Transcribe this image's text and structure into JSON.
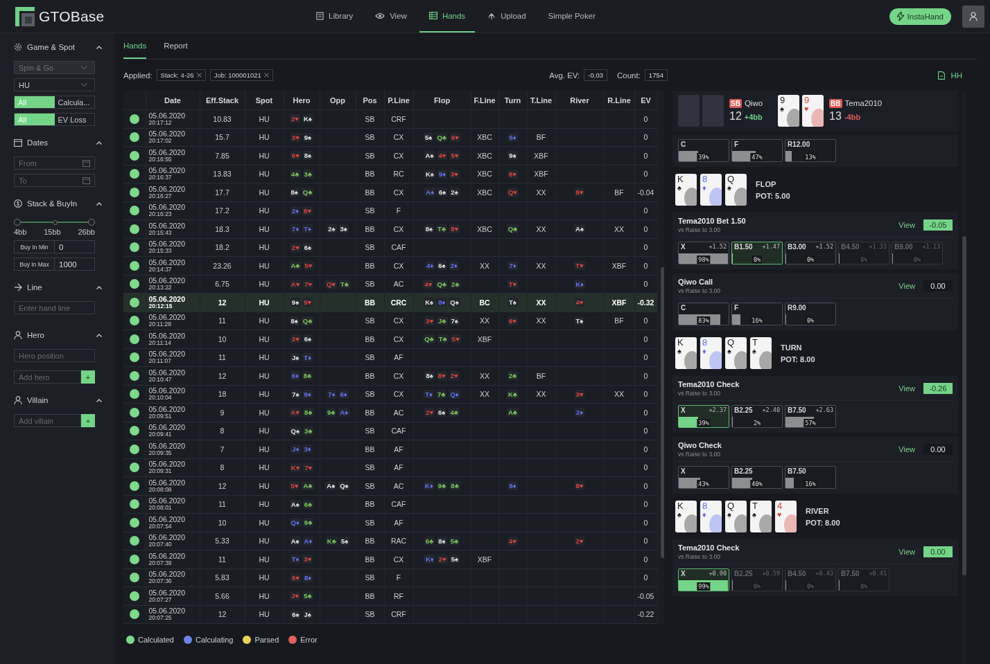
{
  "header": {
    "brand": "GTOBase",
    "nav": [
      {
        "label": "Library",
        "selected": false
      },
      {
        "label": "View",
        "selected": false
      },
      {
        "label": "Hands",
        "selected": true
      },
      {
        "label": "Upload",
        "selected": false
      },
      {
        "label": "Simple Poker",
        "selected": false
      }
    ],
    "insta_button": "InstaHand"
  },
  "sidebar": {
    "sections": [
      {
        "title": "Game & Spot",
        "expanded": true,
        "controls": [
          {
            "kind": "dropdown",
            "value": "Spin & Go",
            "disabled": true
          },
          {
            "kind": "dropdown",
            "value": "HU",
            "disabled": false
          },
          {
            "kind": "toggle",
            "options": [
              {
                "label": "All",
                "selected": true
              },
              {
                "label": "Calcula...",
                "selected": false
              }
            ]
          },
          {
            "kind": "toggle",
            "options": [
              {
                "label": "All",
                "selected": true
              },
              {
                "label": "EV Loss",
                "selected": false
              }
            ]
          }
        ]
      },
      {
        "title": "Dates",
        "expanded": true,
        "controls": [
          {
            "kind": "date",
            "placeholder": "From"
          },
          {
            "kind": "date",
            "placeholder": "To"
          }
        ]
      },
      {
        "title": "Stack & BuyIn",
        "expanded": true,
        "controls": [
          {
            "kind": "range",
            "level": 1,
            "ticks": [
              "4bb",
              "15bb",
              "26bb"
            ]
          },
          {
            "kind": "labeled-input",
            "label": "Buy In Min",
            "value": "0"
          },
          {
            "kind": "labeled-input",
            "label": "Buy In Max",
            "value": "1000"
          }
        ]
      },
      {
        "title": "Line",
        "expanded": true,
        "controls": [
          {
            "kind": "input",
            "placeholder": "Enter hand line"
          }
        ]
      },
      {
        "title": "Hero",
        "expanded": true,
        "controls": [
          {
            "kind": "input",
            "placeholder": "Hero position"
          },
          {
            "kind": "add-input",
            "placeholder": "Add hero",
            "button": "+"
          }
        ]
      },
      {
        "title": "Villain",
        "expanded": true,
        "controls": [
          {
            "kind": "add-input",
            "placeholder": "Add villain",
            "button": "+"
          }
        ]
      }
    ]
  },
  "main": {
    "tabs": [
      {
        "label": "Hands",
        "selected": true
      },
      {
        "label": "Report",
        "selected": false
      }
    ],
    "applied_label": "Applied:",
    "filters": [
      "Stack: 4-26",
      "Job: 100001021"
    ],
    "avg_ev_label": "Avg. EV:",
    "avg_ev": "-0.03",
    "count_label": "Count:",
    "count": "1754",
    "hh_button": "HH"
  },
  "table": {
    "columns": [
      "Date",
      "Eff.Stack",
      "Spot",
      "Hero",
      "Opp",
      "Pos",
      "P.Line",
      "Flop",
      "F.Line",
      "Turn",
      "T.Line",
      "River",
      "R.Line",
      "EV"
    ],
    "rows": [
      {
        "color": "#7ed98a",
        "date": "05.06.2020",
        "time": "20:17:12",
        "eff_stack": "10.83",
        "spot": "HU",
        "hero": [
          {
            "card": "2♥",
            "color": "#d8453e"
          },
          {
            "card": "K♠",
            "color": "#e4e4e4"
          }
        ],
        "pos": "SB",
        "p_line": "CRF",
        "ev": "0",
        "selected": false
      },
      {
        "color": "#7ed98a",
        "date": "05.06.2020",
        "time": "20:17:02",
        "eff_stack": "15.7",
        "spot": "HU",
        "hero": [
          {
            "card": "3♥",
            "color": "#d8453e"
          },
          {
            "card": "9♠",
            "color": "#e4e4e4"
          }
        ],
        "pos": "SB",
        "p_line": "CX",
        "flop": [
          {
            "card": "5♠",
            "color": "#e4e4e4"
          },
          {
            "card": "Q♣",
            "color": "#7bc95a"
          },
          {
            "card": "6♥",
            "color": "#d8453e"
          }
        ],
        "f_line": "XBC",
        "turn": [
          {
            "card": "5♦",
            "color": "#6272f0"
          }
        ],
        "t_line": "BF",
        "ev": "0",
        "selected": false
      },
      {
        "color": "#7ed98a",
        "date": "05.06.2020",
        "time": "20:16:55",
        "eff_stack": "7.85",
        "spot": "HU",
        "hero": [
          {
            "card": "6♥",
            "color": "#d8453e"
          },
          {
            "card": "8♠",
            "color": "#e4e4e4"
          }
        ],
        "pos": "SB",
        "p_line": "CX",
        "flop": [
          {
            "card": "A♠",
            "color": "#e4e4e4"
          },
          {
            "card": "4♥",
            "color": "#d8453e"
          },
          {
            "card": "5♥",
            "color": "#d8453e"
          }
        ],
        "f_line": "XBC",
        "turn": [
          {
            "card": "9♠",
            "color": "#e4e4e4"
          }
        ],
        "t_line": "XBF",
        "ev": "0",
        "selected": false
      },
      {
        "color": "#7ed98a",
        "date": "05.06.2020",
        "time": "20:16:37",
        "eff_stack": "13.83",
        "spot": "HU",
        "hero": [
          {
            "card": "4♣",
            "color": "#7bc95a"
          },
          {
            "card": "3♣",
            "color": "#7bc95a"
          }
        ],
        "pos": "BB",
        "p_line": "RC",
        "flop": [
          {
            "card": "K♠",
            "color": "#e4e4e4"
          },
          {
            "card": "9♦",
            "color": "#6272f0"
          },
          {
            "card": "3♥",
            "color": "#d8453e"
          }
        ],
        "f_line": "XBC",
        "turn": [
          {
            "card": "8♥",
            "color": "#d8453e"
          }
        ],
        "t_line": "XBF",
        "ev": "0",
        "selected": false
      },
      {
        "color": "#7ed98a",
        "date": "05.06.2020",
        "time": "20:16:27",
        "eff_stack": "17.7",
        "spot": "HU",
        "hero": [
          {
            "card": "8♠",
            "color": "#e4e4e4"
          },
          {
            "card": "Q♣",
            "color": "#7bc95a"
          }
        ],
        "pos": "BB",
        "p_line": "CX",
        "flop": [
          {
            "card": "A♦",
            "color": "#6272f0"
          },
          {
            "card": "6♠",
            "color": "#e4e4e4"
          },
          {
            "card": "2♠",
            "color": "#e4e4e4"
          }
        ],
        "f_line": "XBC",
        "turn": [
          {
            "card": "Q♥",
            "color": "#d8453e"
          }
        ],
        "t_line": "XX",
        "river": [
          {
            "card": "8♥",
            "color": "#d8453e"
          }
        ],
        "r_line": "BF",
        "ev": "-0.04",
        "selected": false
      },
      {
        "color": "#7ed98a",
        "date": "05.06.2020",
        "time": "20:16:23",
        "eff_stack": "17.2",
        "spot": "HU",
        "hero": [
          {
            "card": "2♦",
            "color": "#6272f0"
          },
          {
            "card": "8♥",
            "color": "#d8453e"
          }
        ],
        "pos": "SB",
        "p_line": "F",
        "ev": "0",
        "selected": false
      },
      {
        "color": "#7ed98a",
        "date": "05.06.2020",
        "time": "20:15:43",
        "eff_stack": "18.3",
        "spot": "HU",
        "hero": [
          {
            "card": "7♦",
            "color": "#6272f0"
          },
          {
            "card": "T♦",
            "color": "#6272f0"
          }
        ],
        "opp": [
          {
            "card": "2♠",
            "color": "#e4e4e4"
          },
          {
            "card": "3♠",
            "color": "#e4e4e4"
          }
        ],
        "pos": "BB",
        "p_line": "CX",
        "flop": [
          {
            "card": "8♠",
            "color": "#e4e4e4"
          },
          {
            "card": "T♣",
            "color": "#7bc95a"
          },
          {
            "card": "8♥",
            "color": "#d8453e"
          }
        ],
        "f_line": "XBC",
        "turn": [
          {
            "card": "Q♣",
            "color": "#7bc95a"
          }
        ],
        "t_line": "XX",
        "river": [
          {
            "card": "A♠",
            "color": "#e4e4e4"
          }
        ],
        "r_line": "XX",
        "ev": "0",
        "selected": false
      },
      {
        "color": "#7ed98a",
        "date": "05.06.2020",
        "time": "20:15:33",
        "eff_stack": "18.2",
        "spot": "HU",
        "hero": [
          {
            "card": "2♥",
            "color": "#d8453e"
          },
          {
            "card": "6♠",
            "color": "#e4e4e4"
          }
        ],
        "pos": "SB",
        "p_line": "CAF",
        "ev": "0",
        "selected": false
      },
      {
        "color": "#7ed98a",
        "date": "05.06.2020",
        "time": "20:14:37",
        "eff_stack": "23.26",
        "spot": "HU",
        "hero": [
          {
            "card": "A♣",
            "color": "#7bc95a"
          },
          {
            "card": "5♥",
            "color": "#d8453e"
          }
        ],
        "pos": "BB",
        "p_line": "CX",
        "flop": [
          {
            "card": "4♦",
            "color": "#6272f0"
          },
          {
            "card": "6♠",
            "color": "#e4e4e4"
          },
          {
            "card": "2♦",
            "color": "#6272f0"
          }
        ],
        "f_line": "XX",
        "turn": [
          {
            "card": "7♦",
            "color": "#6272f0"
          }
        ],
        "t_line": "XX",
        "river": [
          {
            "card": "T♥",
            "color": "#d8453e"
          }
        ],
        "r_line": "XBF",
        "ev": "0",
        "selected": false
      },
      {
        "color": "#7ed98a",
        "date": "05.06.2020",
        "time": "20:13:22",
        "eff_stack": "6.75",
        "spot": "HU",
        "hero": [
          {
            "card": "A♥",
            "color": "#d8453e"
          },
          {
            "card": "7♥",
            "color": "#d8453e"
          }
        ],
        "opp": [
          {
            "card": "Q♥",
            "color": "#d8453e"
          },
          {
            "card": "T♣",
            "color": "#7bc95a"
          }
        ],
        "pos": "SB",
        "p_line": "AC",
        "flop": [
          {
            "card": "4♥",
            "color": "#d8453e"
          },
          {
            "card": "Q♣",
            "color": "#7bc95a"
          },
          {
            "card": "2♣",
            "color": "#7bc95a"
          }
        ],
        "turn": [
          {
            "card": "T♥",
            "color": "#d8453e"
          }
        ],
        "river": [
          {
            "card": "K♦",
            "color": "#6272f0"
          }
        ],
        "ev": "0",
        "selected": false
      },
      {
        "color": "#7ed98a",
        "date": "05.06.2020",
        "time": "20:12:15",
        "eff_stack": "12",
        "spot": "HU",
        "hero": [
          {
            "card": "9♠",
            "color": "#e4e4e4"
          },
          {
            "card": "9♥",
            "color": "#d8453e"
          }
        ],
        "pos": "BB",
        "p_line": "CRC",
        "flop": [
          {
            "card": "K♠",
            "color": "#e4e4e4"
          },
          {
            "card": "8♦",
            "color": "#6272f0"
          },
          {
            "card": "Q♠",
            "color": "#e4e4e4"
          }
        ],
        "f_line": "BC",
        "turn": [
          {
            "card": "T♠",
            "color": "#e4e4e4"
          }
        ],
        "t_line": "XX",
        "river": [
          {
            "card": "4♥",
            "color": "#d8453e"
          }
        ],
        "r_line": "XBF",
        "ev": "-0.32",
        "selected": true
      },
      {
        "color": "#7ed98a",
        "date": "05.06.2020",
        "time": "20:11:28",
        "eff_stack": "11",
        "spot": "HU",
        "hero": [
          {
            "card": "8♠",
            "color": "#e4e4e4"
          },
          {
            "card": "Q♣",
            "color": "#7bc95a"
          }
        ],
        "pos": "SB",
        "p_line": "CX",
        "flop": [
          {
            "card": "3♥",
            "color": "#d8453e"
          },
          {
            "card": "J♣",
            "color": "#7bc95a"
          },
          {
            "card": "7♠",
            "color": "#e4e4e4"
          }
        ],
        "f_line": "XX",
        "turn": [
          {
            "card": "6♥",
            "color": "#d8453e"
          }
        ],
        "t_line": "XX",
        "river": [
          {
            "card": "T♠",
            "color": "#e4e4e4"
          }
        ],
        "r_line": "BF",
        "ev": "0",
        "selected": false
      },
      {
        "color": "#7ed98a",
        "date": "05.06.2020",
        "time": "20:11:14",
        "eff_stack": "10",
        "spot": "HU",
        "hero": [
          {
            "card": "3♥",
            "color": "#d8453e"
          },
          {
            "card": "6♠",
            "color": "#e4e4e4"
          }
        ],
        "pos": "BB",
        "p_line": "CX",
        "flop": [
          {
            "card": "Q♣",
            "color": "#7bc95a"
          },
          {
            "card": "T♣",
            "color": "#7bc95a"
          },
          {
            "card": "5♥",
            "color": "#d8453e"
          }
        ],
        "f_line": "XBF",
        "ev": "0",
        "selected": false
      },
      {
        "color": "#7ed98a",
        "date": "05.06.2020",
        "time": "20:11:07",
        "eff_stack": "11",
        "spot": "HU",
        "hero": [
          {
            "card": "J♠",
            "color": "#e4e4e4"
          },
          {
            "card": "T♦",
            "color": "#6272f0"
          }
        ],
        "pos": "SB",
        "p_line": "AF",
        "ev": "0",
        "selected": false
      },
      {
        "color": "#7ed98a",
        "date": "05.06.2020",
        "time": "20:10:47",
        "eff_stack": "12",
        "spot": "HU",
        "hero": [
          {
            "card": "6♦",
            "color": "#6272f0"
          },
          {
            "card": "8♣",
            "color": "#7bc95a"
          }
        ],
        "pos": "BB",
        "p_line": "CX",
        "flop": [
          {
            "card": "8♠",
            "color": "#e4e4e4"
          },
          {
            "card": "8♥",
            "color": "#d8453e"
          },
          {
            "card": "2♥",
            "color": "#d8453e"
          }
        ],
        "f_line": "XX",
        "turn": [
          {
            "card": "2♣",
            "color": "#7bc95a"
          }
        ],
        "t_line": "BF",
        "ev": "0",
        "selected": false
      },
      {
        "color": "#7ed98a",
        "date": "05.06.2020",
        "time": "20:10:04",
        "eff_stack": "18",
        "spot": "HU",
        "hero": [
          {
            "card": "7♠",
            "color": "#e4e4e4"
          },
          {
            "card": "9♦",
            "color": "#6272f0"
          }
        ],
        "opp": [
          {
            "card": "7♦",
            "color": "#6272f0"
          },
          {
            "card": "6♦",
            "color": "#6272f0"
          }
        ],
        "pos": "SB",
        "p_line": "CX",
        "flop": [
          {
            "card": "T♦",
            "color": "#6272f0"
          },
          {
            "card": "7♣",
            "color": "#7bc95a"
          },
          {
            "card": "Q♦",
            "color": "#6272f0"
          }
        ],
        "f_line": "XX",
        "turn": [
          {
            "card": "K♣",
            "color": "#7bc95a"
          }
        ],
        "t_line": "XX",
        "river": [
          {
            "card": "3♥",
            "color": "#d8453e"
          }
        ],
        "r_line": "XX",
        "ev": "0",
        "selected": false
      },
      {
        "color": "#7ed98a",
        "date": "05.06.2020",
        "time": "20:09:51",
        "eff_stack": "9",
        "spot": "HU",
        "hero": [
          {
            "card": "A♥",
            "color": "#d8453e"
          },
          {
            "card": "8♣",
            "color": "#7bc95a"
          }
        ],
        "opp": [
          {
            "card": "9♣",
            "color": "#7bc95a"
          },
          {
            "card": "A♦",
            "color": "#6272f0"
          }
        ],
        "pos": "BB",
        "p_line": "AC",
        "flop": [
          {
            "card": "2♥",
            "color": "#d8453e"
          },
          {
            "card": "6♠",
            "color": "#e4e4e4"
          },
          {
            "card": "4♣",
            "color": "#7bc95a"
          }
        ],
        "turn": [
          {
            "card": "A♣",
            "color": "#7bc95a"
          }
        ],
        "river": [
          {
            "card": "2♦",
            "color": "#6272f0"
          }
        ],
        "ev": "0",
        "selected": false
      },
      {
        "color": "#7ed98a",
        "date": "05.06.2020",
        "time": "20:09:41",
        "eff_stack": "8",
        "spot": "HU",
        "hero": [
          {
            "card": "Q♠",
            "color": "#e4e4e4"
          },
          {
            "card": "3♣",
            "color": "#7bc95a"
          }
        ],
        "pos": "SB",
        "p_line": "CAF",
        "ev": "0",
        "selected": false
      },
      {
        "color": "#7ed98a",
        "date": "05.06.2020",
        "time": "20:09:35",
        "eff_stack": "7",
        "spot": "HU",
        "hero": [
          {
            "card": "J♦",
            "color": "#6272f0"
          },
          {
            "card": "3♦",
            "color": "#6272f0"
          }
        ],
        "pos": "BB",
        "p_line": "AF",
        "ev": "0",
        "selected": false
      },
      {
        "color": "#7ed98a",
        "date": "05.06.2020",
        "time": "20:09:31",
        "eff_stack": "8",
        "spot": "HU",
        "hero": [
          {
            "card": "K♥",
            "color": "#d8453e"
          },
          {
            "card": "7♥",
            "color": "#d8453e"
          }
        ],
        "pos": "SB",
        "p_line": "AF",
        "ev": "0",
        "selected": false
      },
      {
        "color": "#7ed98a",
        "date": "05.06.2020",
        "time": "20:08:08",
        "eff_stack": "12",
        "spot": "HU",
        "hero": [
          {
            "card": "5♥",
            "color": "#d8453e"
          },
          {
            "card": "A♣",
            "color": "#7bc95a"
          }
        ],
        "opp": [
          {
            "card": "A♠",
            "color": "#e4e4e4"
          },
          {
            "card": "Q♠",
            "color": "#e4e4e4"
          }
        ],
        "pos": "SB",
        "p_line": "AC",
        "flop": [
          {
            "card": "K♦",
            "color": "#6272f0"
          },
          {
            "card": "9♣",
            "color": "#7bc95a"
          },
          {
            "card": "8♣",
            "color": "#7bc95a"
          }
        ],
        "turn": [
          {
            "card": "6♦",
            "color": "#6272f0"
          }
        ],
        "river": [
          {
            "card": "8♥",
            "color": "#d8453e"
          }
        ],
        "ev": "0",
        "selected": false
      },
      {
        "color": "#7ed98a",
        "date": "05.06.2020",
        "time": "20:08:01",
        "eff_stack": "11",
        "spot": "HU",
        "hero": [
          {
            "card": "A♠",
            "color": "#e4e4e4"
          },
          {
            "card": "6♣",
            "color": "#7bc95a"
          }
        ],
        "pos": "BB",
        "p_line": "CAF",
        "ev": "0",
        "selected": false
      },
      {
        "color": "#7ed98a",
        "date": "05.06.2020",
        "time": "20:07:54",
        "eff_stack": "10",
        "spot": "HU",
        "hero": [
          {
            "card": "Q♦",
            "color": "#6272f0"
          },
          {
            "card": "9♣",
            "color": "#7bc95a"
          }
        ],
        "pos": "SB",
        "p_line": "AF",
        "ev": "0",
        "selected": false
      },
      {
        "color": "#7ed98a",
        "date": "05.06.2020",
        "time": "20:07:40",
        "eff_stack": "5.33",
        "spot": "HU",
        "hero": [
          {
            "card": "A♠",
            "color": "#e4e4e4"
          },
          {
            "card": "A♦",
            "color": "#6272f0"
          }
        ],
        "opp": [
          {
            "card": "K♣",
            "color": "#7bc95a"
          },
          {
            "card": "5♠",
            "color": "#e4e4e4"
          }
        ],
        "pos": "BB",
        "p_line": "RAC",
        "flop": [
          {
            "card": "6♣",
            "color": "#7bc95a"
          },
          {
            "card": "8♠",
            "color": "#e4e4e4"
          },
          {
            "card": "5♣",
            "color": "#7bc95a"
          }
        ],
        "turn": [
          {
            "card": "4♥",
            "color": "#d8453e"
          }
        ],
        "river": [
          {
            "card": "2♥",
            "color": "#d8453e"
          }
        ],
        "ev": "0",
        "selected": false
      },
      {
        "color": "#7ed98a",
        "date": "05.06.2020",
        "time": "20:07:39",
        "eff_stack": "11",
        "spot": "HU",
        "hero": [
          {
            "card": "T♦",
            "color": "#6272f0"
          },
          {
            "card": "3♥",
            "color": "#d8453e"
          }
        ],
        "pos": "BB",
        "p_line": "CX",
        "flop": [
          {
            "card": "K♦",
            "color": "#6272f0"
          },
          {
            "card": "2♥",
            "color": "#d8453e"
          },
          {
            "card": "5♠",
            "color": "#e4e4e4"
          }
        ],
        "f_line": "XBF",
        "ev": "0",
        "selected": false
      },
      {
        "color": "#7ed98a",
        "date": "05.06.2020",
        "time": "20:07:36",
        "eff_stack": "5.83",
        "spot": "HU",
        "hero": [
          {
            "card": "6♥",
            "color": "#d8453e"
          },
          {
            "card": "8♦",
            "color": "#6272f0"
          }
        ],
        "pos": "SB",
        "p_line": "F",
        "ev": "0",
        "selected": false
      },
      {
        "color": "#7ed98a",
        "date": "05.06.2020",
        "time": "20:07:27",
        "eff_stack": "5.66",
        "spot": "HU",
        "hero": [
          {
            "card": "J♥",
            "color": "#d8453e"
          },
          {
            "card": "5♣",
            "color": "#7bc95a"
          }
        ],
        "pos": "BB",
        "p_line": "RF",
        "ev": "-0.05",
        "selected": false
      },
      {
        "color": "#7ed98a",
        "date": "05.06.2020",
        "time": "20:07:25",
        "eff_stack": "12",
        "spot": "HU",
        "hero": [
          {
            "card": "6♠",
            "color": "#e4e4e4"
          },
          {
            "card": "J♠",
            "color": "#e4e4e4"
          }
        ],
        "pos": "SB",
        "p_line": "CRF",
        "ev": "-0.22",
        "selected": false
      }
    ]
  },
  "legend": [
    {
      "label": "Calculated",
      "color": "#7ed98a"
    },
    {
      "label": "Calculating",
      "color": "#6b86e8"
    },
    {
      "label": "Parsed",
      "color": "#e8d25a"
    },
    {
      "label": "Error",
      "color": "#e0605a"
    }
  ],
  "panel": {
    "players": [
      {
        "position": "SB",
        "name": "Qiwo",
        "stack": "12",
        "result": "+4bb",
        "color": "#6fd08a",
        "cards_shown": false
      },
      {
        "position": "BB",
        "name": "Tema2010",
        "stack": "13",
        "result": "-4bb",
        "color": "#e0605a",
        "cards_shown": true,
        "cards": [
          {
            "rank": "9",
            "suit": "♠",
            "color": "#1a1a1a"
          },
          {
            "rank": "9",
            "suit": "♥",
            "color": "#d8453e"
          }
        ]
      }
    ],
    "streets": [
      {
        "kind": "decision",
        "options": [
          {
            "label": "C",
            "freq": "39%",
            "level": 0.39,
            "played": false,
            "dimmed": false
          },
          {
            "label": "F",
            "freq": "47%",
            "level": 0.47,
            "played": false,
            "dimmed": false
          },
          {
            "label": "R12.00",
            "freq": "13%",
            "level": 0.13,
            "played": false,
            "dimmed": false
          }
        ]
      },
      {
        "kind": "board",
        "street": "FLOP",
        "pot": "POT: 5.00",
        "cards": [
          {
            "rank": "K",
            "suit": "♠",
            "color": "#1a1a1a"
          },
          {
            "rank": "8",
            "suit": "♦",
            "color": "#5b6cf0"
          },
          {
            "rank": "Q",
            "suit": "♠",
            "color": "#1a1a1a"
          }
        ]
      },
      {
        "kind": "decision",
        "title": "Tema2010 Bet 1.50",
        "subtitle": "vs Raise to 3.00",
        "link": "View",
        "ev": "-0.05",
        "highlighted": true,
        "options": [
          {
            "label": "X",
            "ev": "+1.52",
            "freq": "98%",
            "level": 0.98,
            "played": false,
            "dimmed": false
          },
          {
            "label": "B1.50",
            "ev": "+1.47",
            "freq": "0%",
            "level": 0,
            "played": true,
            "dimmed": false
          },
          {
            "label": "B3.00",
            "ev": "+1.52",
            "freq": "0%",
            "level": 0,
            "played": false,
            "dimmed": false
          },
          {
            "label": "B4.50",
            "ev": "+1.33",
            "freq": "0%",
            "level": 0,
            "played": false,
            "dimmed": true
          },
          {
            "label": "B9.00",
            "ev": "+1.13",
            "freq": "0%",
            "level": 0,
            "played": false,
            "dimmed": true
          }
        ]
      },
      {
        "kind": "decision",
        "title": "Qiwo Call",
        "subtitle": "vs Raise to 3.00",
        "link": "View",
        "ev": "0.00",
        "highlighted": false,
        "options": [
          {
            "label": "C",
            "freq": "83%",
            "level": 0.83,
            "played": false,
            "dimmed": false
          },
          {
            "label": "F",
            "freq": "16%",
            "level": 0.16,
            "played": false,
            "dimmed": false
          },
          {
            "label": "R9.00",
            "freq": "0%",
            "level": 0,
            "played": false,
            "dimmed": false
          }
        ]
      },
      {
        "kind": "board",
        "street": "TURN",
        "pot": "POT: 8.00",
        "cards": [
          {
            "rank": "K",
            "suit": "♠",
            "color": "#1a1a1a"
          },
          {
            "rank": "8",
            "suit": "♦",
            "color": "#5b6cf0"
          },
          {
            "rank": "Q",
            "suit": "♠",
            "color": "#1a1a1a"
          },
          {
            "rank": "T",
            "suit": "♠",
            "color": "#1a1a1a"
          }
        ]
      },
      {
        "kind": "decision",
        "title": "Tema2010 Check",
        "subtitle": "vs Raise to 3.00",
        "link": "View",
        "ev": "-0.26",
        "highlighted": true,
        "options": [
          {
            "label": "X",
            "ev": "+2.37",
            "freq": "39%",
            "level": 0.39,
            "played": true,
            "dimmed": false
          },
          {
            "label": "B2.25",
            "ev": "+2.40",
            "freq": "2%",
            "level": 0.02,
            "played": false,
            "dimmed": false
          },
          {
            "label": "B7.50",
            "ev": "+2.63",
            "freq": "57%",
            "level": 0.57,
            "played": false,
            "dimmed": false
          }
        ]
      },
      {
        "kind": "decision",
        "title": "Qiwo Check",
        "subtitle": "vs Raise to 3.00",
        "link": "View",
        "ev": "0.00",
        "highlighted": false,
        "options": [
          {
            "label": "X",
            "freq": "43%",
            "level": 0.43,
            "played": false,
            "dimmed": false
          },
          {
            "label": "B2.25",
            "freq": "40%",
            "level": 0.4,
            "played": false,
            "dimmed": false
          },
          {
            "label": "B7.50",
            "freq": "16%",
            "level": 0.16,
            "played": false,
            "dimmed": false
          }
        ]
      },
      {
        "kind": "board",
        "street": "RIVER",
        "pot": "POT: 8.00",
        "cards": [
          {
            "rank": "K",
            "suit": "♠",
            "color": "#1a1a1a"
          },
          {
            "rank": "8",
            "suit": "♦",
            "color": "#5b6cf0"
          },
          {
            "rank": "Q",
            "suit": "♠",
            "color": "#1a1a1a"
          },
          {
            "rank": "T",
            "suit": "♠",
            "color": "#1a1a1a"
          },
          {
            "rank": "4",
            "suit": "♥",
            "color": "#d8453e"
          }
        ]
      },
      {
        "kind": "decision",
        "title": "Tema2010 Check",
        "subtitle": "vs Raise to 3.00",
        "link": "View",
        "ev": "0.00",
        "highlighted": true,
        "options": [
          {
            "label": "X",
            "ev": "+0.90",
            "freq": "99%",
            "level": 0.99,
            "played": true,
            "dimmed": false
          },
          {
            "label": "B2.25",
            "ev": "+0.59",
            "freq": "0%",
            "level": 0,
            "played": false,
            "dimmed": true
          },
          {
            "label": "B4.50",
            "ev": "+0.43",
            "freq": "0%",
            "level": 0,
            "played": false,
            "dimmed": true
          },
          {
            "label": "B7.50",
            "ev": "+0.41",
            "freq": "0%",
            "level": 0,
            "played": false,
            "dimmed": true
          }
        ]
      }
    ]
  }
}
